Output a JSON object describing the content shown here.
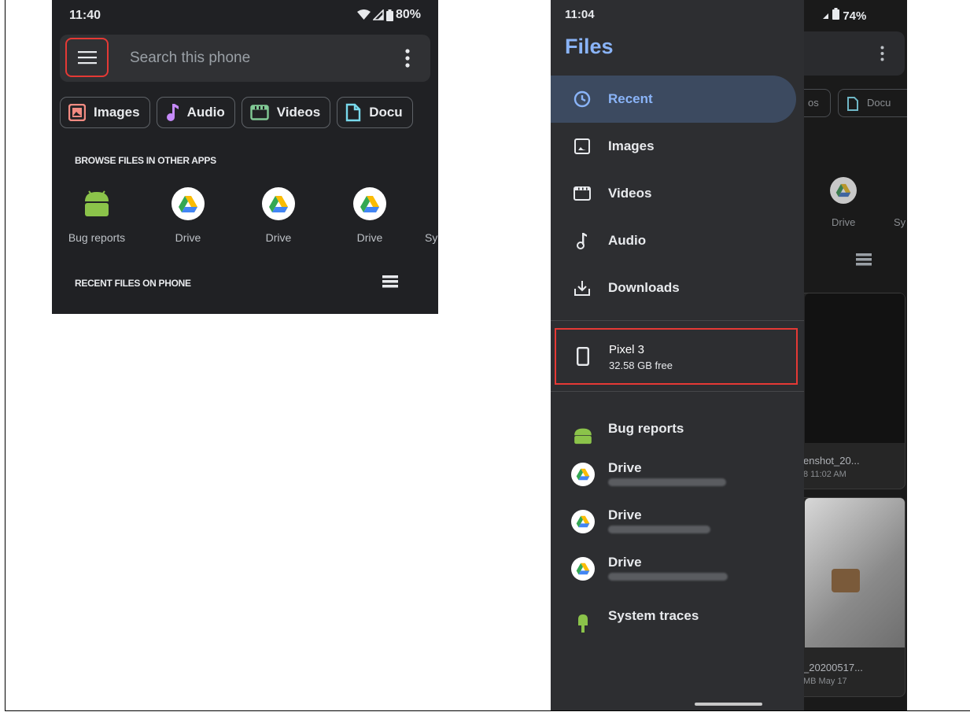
{
  "left": {
    "status": {
      "time": "11:40",
      "battery": "80%"
    },
    "search": {
      "placeholder": "Search this phone"
    },
    "chips": [
      {
        "label": "Images",
        "icon": "image-icon",
        "color": "#f28b82"
      },
      {
        "label": "Audio",
        "icon": "music-note-icon",
        "color": "#c58af9"
      },
      {
        "label": "Videos",
        "icon": "video-icon",
        "color": "#81c995"
      },
      {
        "label": "Docu",
        "icon": "document-icon",
        "color": "#78d9ec"
      }
    ],
    "browse_title": "BROWSE FILES IN OTHER APPS",
    "apps": [
      {
        "label": "Bug reports",
        "icon": "android-icon"
      },
      {
        "label": "Drive",
        "icon": "drive-icon"
      },
      {
        "label": "Drive",
        "icon": "drive-icon"
      },
      {
        "label": "Drive",
        "icon": "drive-icon"
      },
      {
        "label": "Sy",
        "icon": "android-icon"
      }
    ],
    "recent_title": "RECENT FILES ON PHONE"
  },
  "right": {
    "status": {
      "time": "11:04",
      "battery": "74%"
    },
    "drawer_title": "Files",
    "nav": [
      {
        "label": "Recent",
        "icon": "clock-icon",
        "selected": true
      },
      {
        "label": "Images",
        "icon": "image-icon"
      },
      {
        "label": "Videos",
        "icon": "video-icon"
      },
      {
        "label": "Audio",
        "icon": "music-note-icon"
      },
      {
        "label": "Downloads",
        "icon": "download-icon"
      }
    ],
    "storage": {
      "name": "Pixel 3",
      "free": "32.58 GB free"
    },
    "accounts": [
      {
        "label": "Bug reports",
        "icon": "android-icon"
      },
      {
        "label": "Drive",
        "icon": "drive-icon"
      },
      {
        "label": "Drive",
        "icon": "drive-icon"
      },
      {
        "label": "Drive",
        "icon": "drive-icon"
      },
      {
        "label": "System traces",
        "icon": "android-icon"
      }
    ],
    "background": {
      "chips": [
        "os",
        "Docu"
      ],
      "drive_label": "Drive",
      "sy_label": "Sy",
      "card1_title": "enshot_20...",
      "card1_meta": "8 11:02 AM",
      "card2_title": "_20200517...",
      "card2_meta": "MB May 17"
    }
  },
  "colors": {
    "accent": "#8ab4f8",
    "highlight": "#e53935",
    "android": "#8bc34a"
  }
}
